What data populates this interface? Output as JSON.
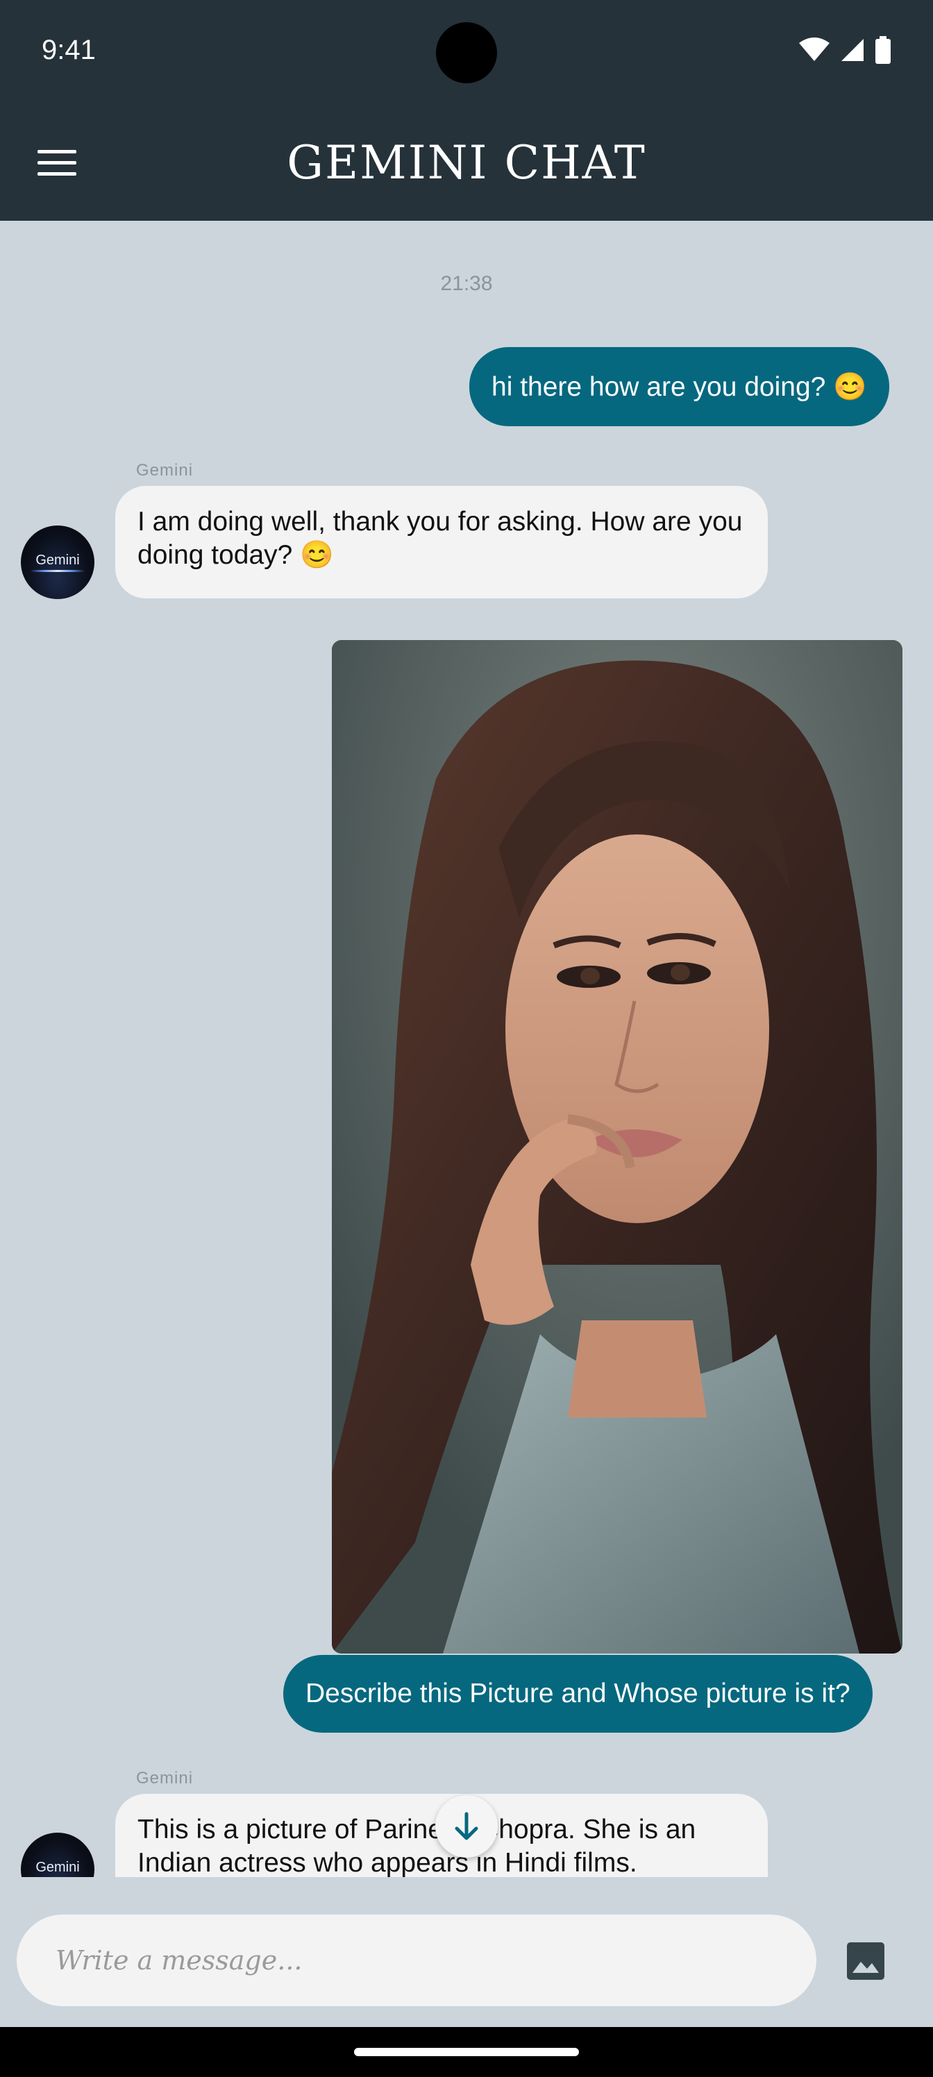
{
  "status_bar": {
    "time": "9:41"
  },
  "app_bar": {
    "title": "GEMINI CHAT",
    "menu_icon": "hamburger-menu-icon"
  },
  "chat": {
    "timestamp": "21:38",
    "messages": [
      {
        "role": "user",
        "text": "hi there how are you doing? 😊"
      },
      {
        "role": "bot",
        "sender": "Gemini",
        "avatar_label": "Gemini",
        "text": " I am doing well, thank you for asking. How are you doing today? 😊"
      },
      {
        "role": "user",
        "type": "image",
        "image_icon": "woman-portrait-photo"
      },
      {
        "role": "user",
        "text": "Describe this Picture and Whose picture is it?"
      },
      {
        "role": "bot",
        "sender": "Gemini",
        "avatar_label": "Gemini",
        "text": " This is a picture of Parineeti Chopra. She is an Indian actress who appears in Hindi films."
      }
    ],
    "scroll_button_icon": "arrow-down-icon"
  },
  "composer": {
    "placeholder": "Write a message...",
    "attach_icon": "image-icon"
  },
  "colors": {
    "app_bar": "#253239",
    "background": "#ccd5dc",
    "user_bubble": "#05687f",
    "bot_bubble": "#f3f3f3"
  }
}
